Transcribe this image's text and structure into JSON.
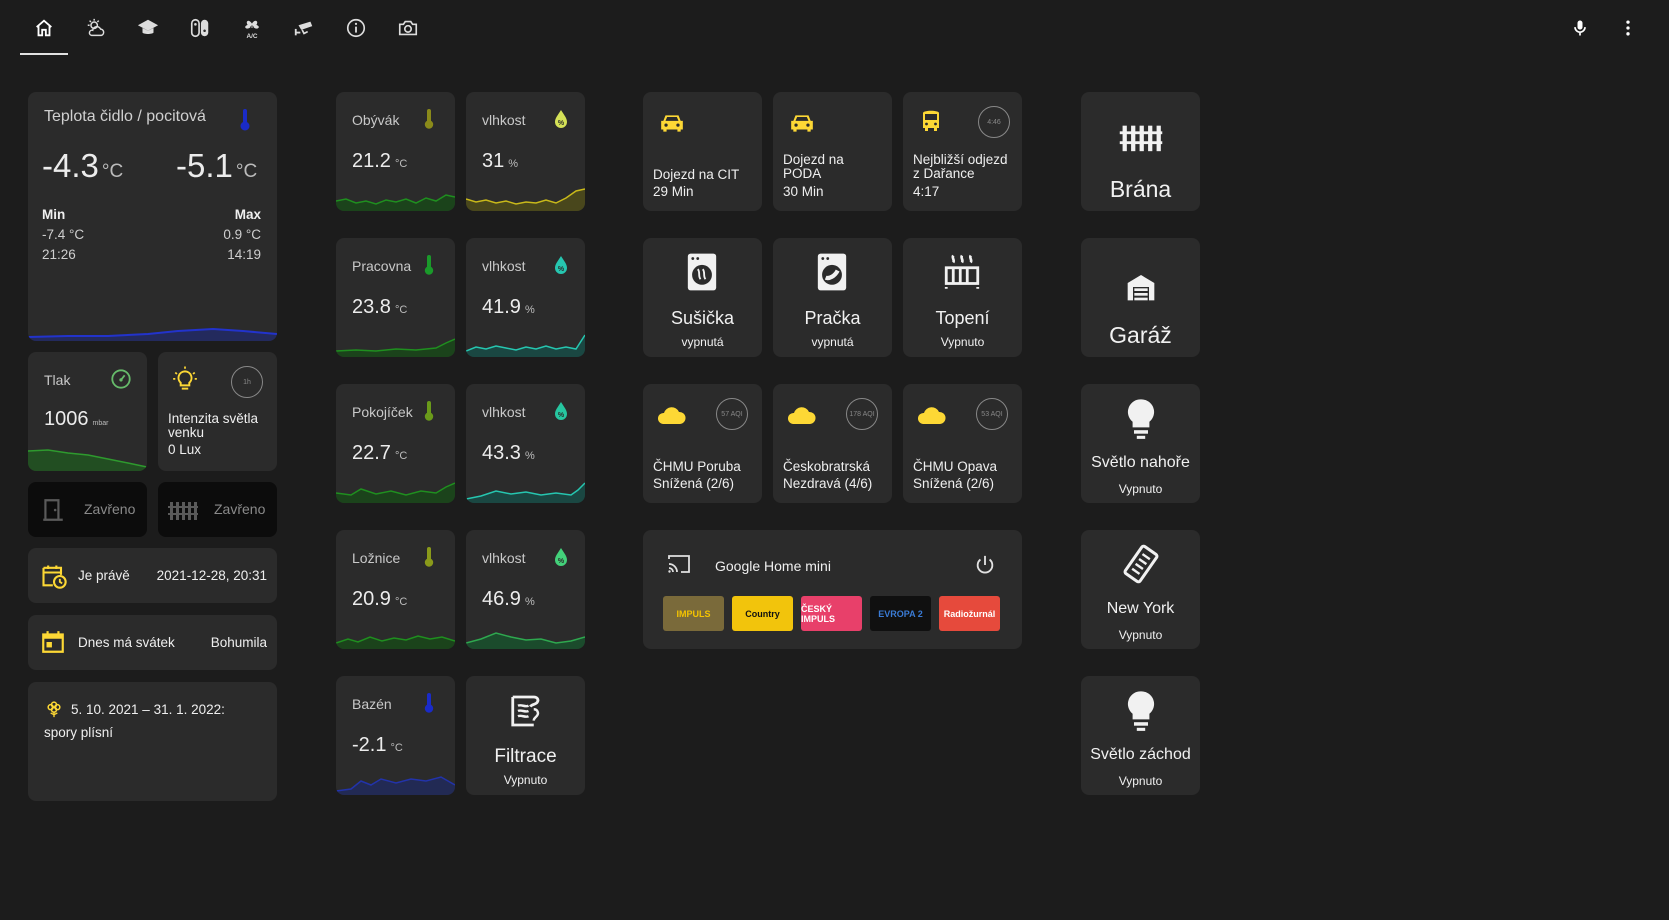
{
  "colors": {
    "background": "#1c1c1c",
    "card": "#2b2b2b",
    "accent_yellow": "#fdd835",
    "sensor_green": "#1b8a1b",
    "humidity_cyan": "#26c6b0"
  },
  "tabs": [
    {
      "icon": "home-icon"
    },
    {
      "icon": "weather-partly-cloudy-icon"
    },
    {
      "icon": "school-icon"
    },
    {
      "icon": "nintendo-switch-icon"
    },
    {
      "icon": "air-conditioner-icon"
    },
    {
      "icon": "cctv-camera-icon"
    },
    {
      "icon": "info-icon"
    },
    {
      "icon": "camera-icon"
    }
  ],
  "toolbar": {
    "mic_icon": "microphone-icon",
    "menu_icon": "dots-vertical-icon"
  },
  "weather": {
    "title": "Teplota čidlo / pocitová",
    "temp": "-4.3",
    "feels": "-5.1",
    "unit": "°C",
    "min_label": "Min",
    "max_label": "Max",
    "min_value": "-7.4 °C",
    "max_value": "0.9 °C",
    "min_time": "21:26",
    "max_time": "14:19"
  },
  "pressure": {
    "label": "Tlak",
    "value": "1006",
    "unit": "mbar"
  },
  "light_sensor": {
    "badge": "1h",
    "label": "Intenzita světla venku",
    "value": "0 Lux"
  },
  "door": {
    "state": "Zavřeno"
  },
  "gate_status": {
    "state": "Zavřeno"
  },
  "now": {
    "label": "Je právě",
    "value": "2021-12-28, 20:31"
  },
  "nameday": {
    "label": "Dnes má svátek",
    "value": "Bohumila"
  },
  "pollen": {
    "line1": "5. 10. 2021 – 31. 1. 2022:",
    "line2": "spory plísní"
  },
  "rooms": [
    {
      "name": "Obývák",
      "temp": "21.2",
      "temp_unit": "°C",
      "hum_label": "vlhkost",
      "hum": "31",
      "hum_unit": "%"
    },
    {
      "name": "Pracovna",
      "temp": "23.8",
      "temp_unit": "°C",
      "hum_label": "vlhkost",
      "hum": "41.9",
      "hum_unit": "%"
    },
    {
      "name": "Pokojíček",
      "temp": "22.7",
      "temp_unit": "°C",
      "hum_label": "vlhkost",
      "hum": "43.3",
      "hum_unit": "%"
    },
    {
      "name": "Ložnice",
      "temp": "20.9",
      "temp_unit": "°C",
      "hum_label": "vlhkost",
      "hum": "46.9",
      "hum_unit": "%"
    }
  ],
  "pool": {
    "name": "Bazén",
    "temp": "-2.1",
    "temp_unit": "°C"
  },
  "filtration": {
    "name": "Filtrace",
    "state": "Vypnuto"
  },
  "commute": [
    {
      "label": "Dojezd na CIT",
      "value": "29 Min"
    },
    {
      "label": "Dojezd na PODA",
      "value": "30 Min"
    },
    {
      "label": "Nejbližší odjezd z Dařance",
      "value": "4:17",
      "badge": "4:46"
    }
  ],
  "appliances": [
    {
      "name": "Sušička",
      "state": "vypnutá"
    },
    {
      "name": "Pračka",
      "state": "vypnutá"
    },
    {
      "name": "Topení",
      "state": "Vypnuto"
    }
  ],
  "air": [
    {
      "label": "ČHMU Poruba Snížená (2/6)",
      "badge": "57 AQI"
    },
    {
      "label": "Českobratrská Nezdravá (4/6)",
      "badge": "178 AQI"
    },
    {
      "label": "ČHMU Opava Snížená (2/6)",
      "badge": "53 AQI"
    }
  ],
  "media": {
    "name": "Google Home mini",
    "stations": [
      {
        "label": "IMPULS",
        "bg": "#7a6a3a",
        "fg": "#f5c400"
      },
      {
        "label": "Country",
        "bg": "#f2c40c",
        "fg": "#111111"
      },
      {
        "label": "ČESKÝ IMPULS",
        "bg": "#e8406a",
        "fg": "#ffffff"
      },
      {
        "label": "EVROPA 2",
        "bg": "#101010",
        "fg": "#3a7bd5"
      },
      {
        "label": "Radiožurnál",
        "bg": "#e64a3c",
        "fg": "#ffffff"
      }
    ]
  },
  "controls": [
    {
      "name": "Brána",
      "state": ""
    },
    {
      "name": "Garáž",
      "state": ""
    },
    {
      "name": "Světlo nahoře",
      "state": "Vypnuto"
    },
    {
      "name": "New York",
      "state": "Vypnuto"
    },
    {
      "name": "Světlo záchod",
      "state": "Vypnuto"
    }
  ]
}
